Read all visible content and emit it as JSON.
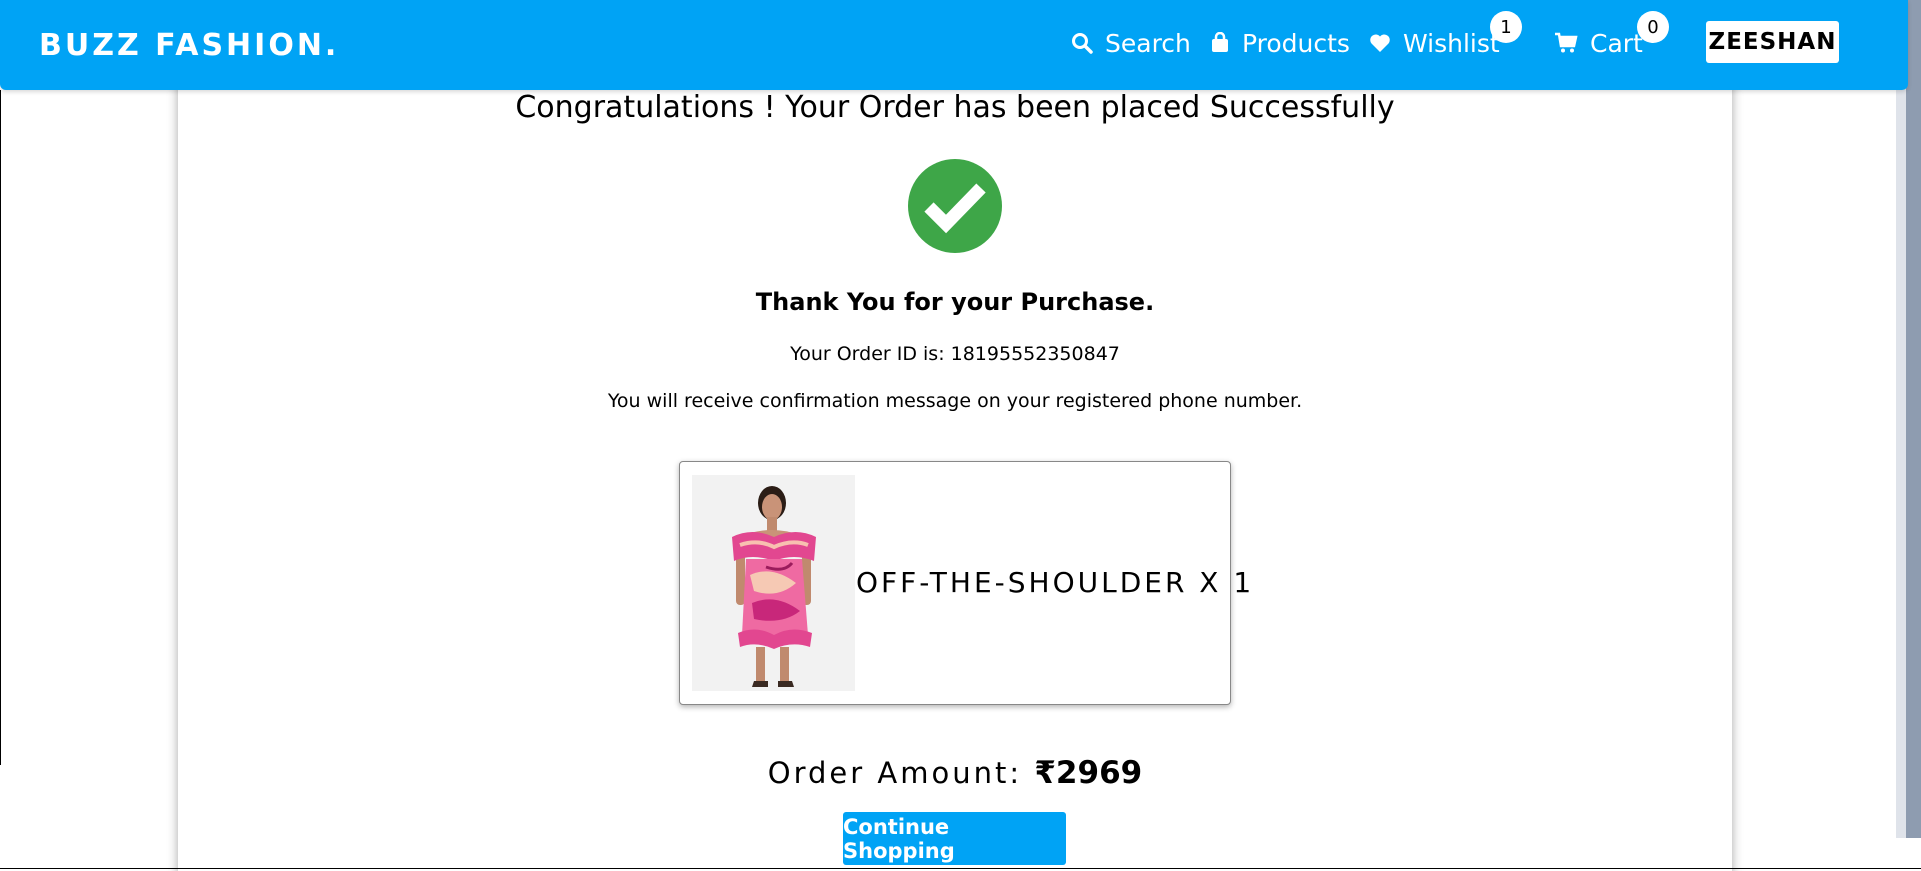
{
  "navbar": {
    "brand": "BUZZ FASHION.",
    "search_label": "Search",
    "products_label": "Products",
    "wishlist_label": "Wishlist",
    "wishlist_count": "1",
    "cart_label": "Cart",
    "cart_count": "0",
    "user_name": "ZEESHAN"
  },
  "confirmation": {
    "title": "Congratulations ! Your Order has been placed Successfully",
    "thanks": "Thank You for your Purchase.",
    "order_id_text": "Your Order ID is: 18195552350847",
    "message": "You will receive confirmation message on your registered phone number."
  },
  "order_item": {
    "name_qty": "OFF-THE-SHOULDER X 1"
  },
  "order_amount": {
    "label": "Order Amount:",
    "value": "₹2969"
  },
  "continue_button_label": "Continue Shopping",
  "colors": {
    "brand_blue": "#00a3f5",
    "success_green": "#3ea648"
  },
  "icons": [
    "search-icon",
    "bag-icon",
    "heart-icon",
    "cart-icon",
    "check-circle-icon"
  ]
}
